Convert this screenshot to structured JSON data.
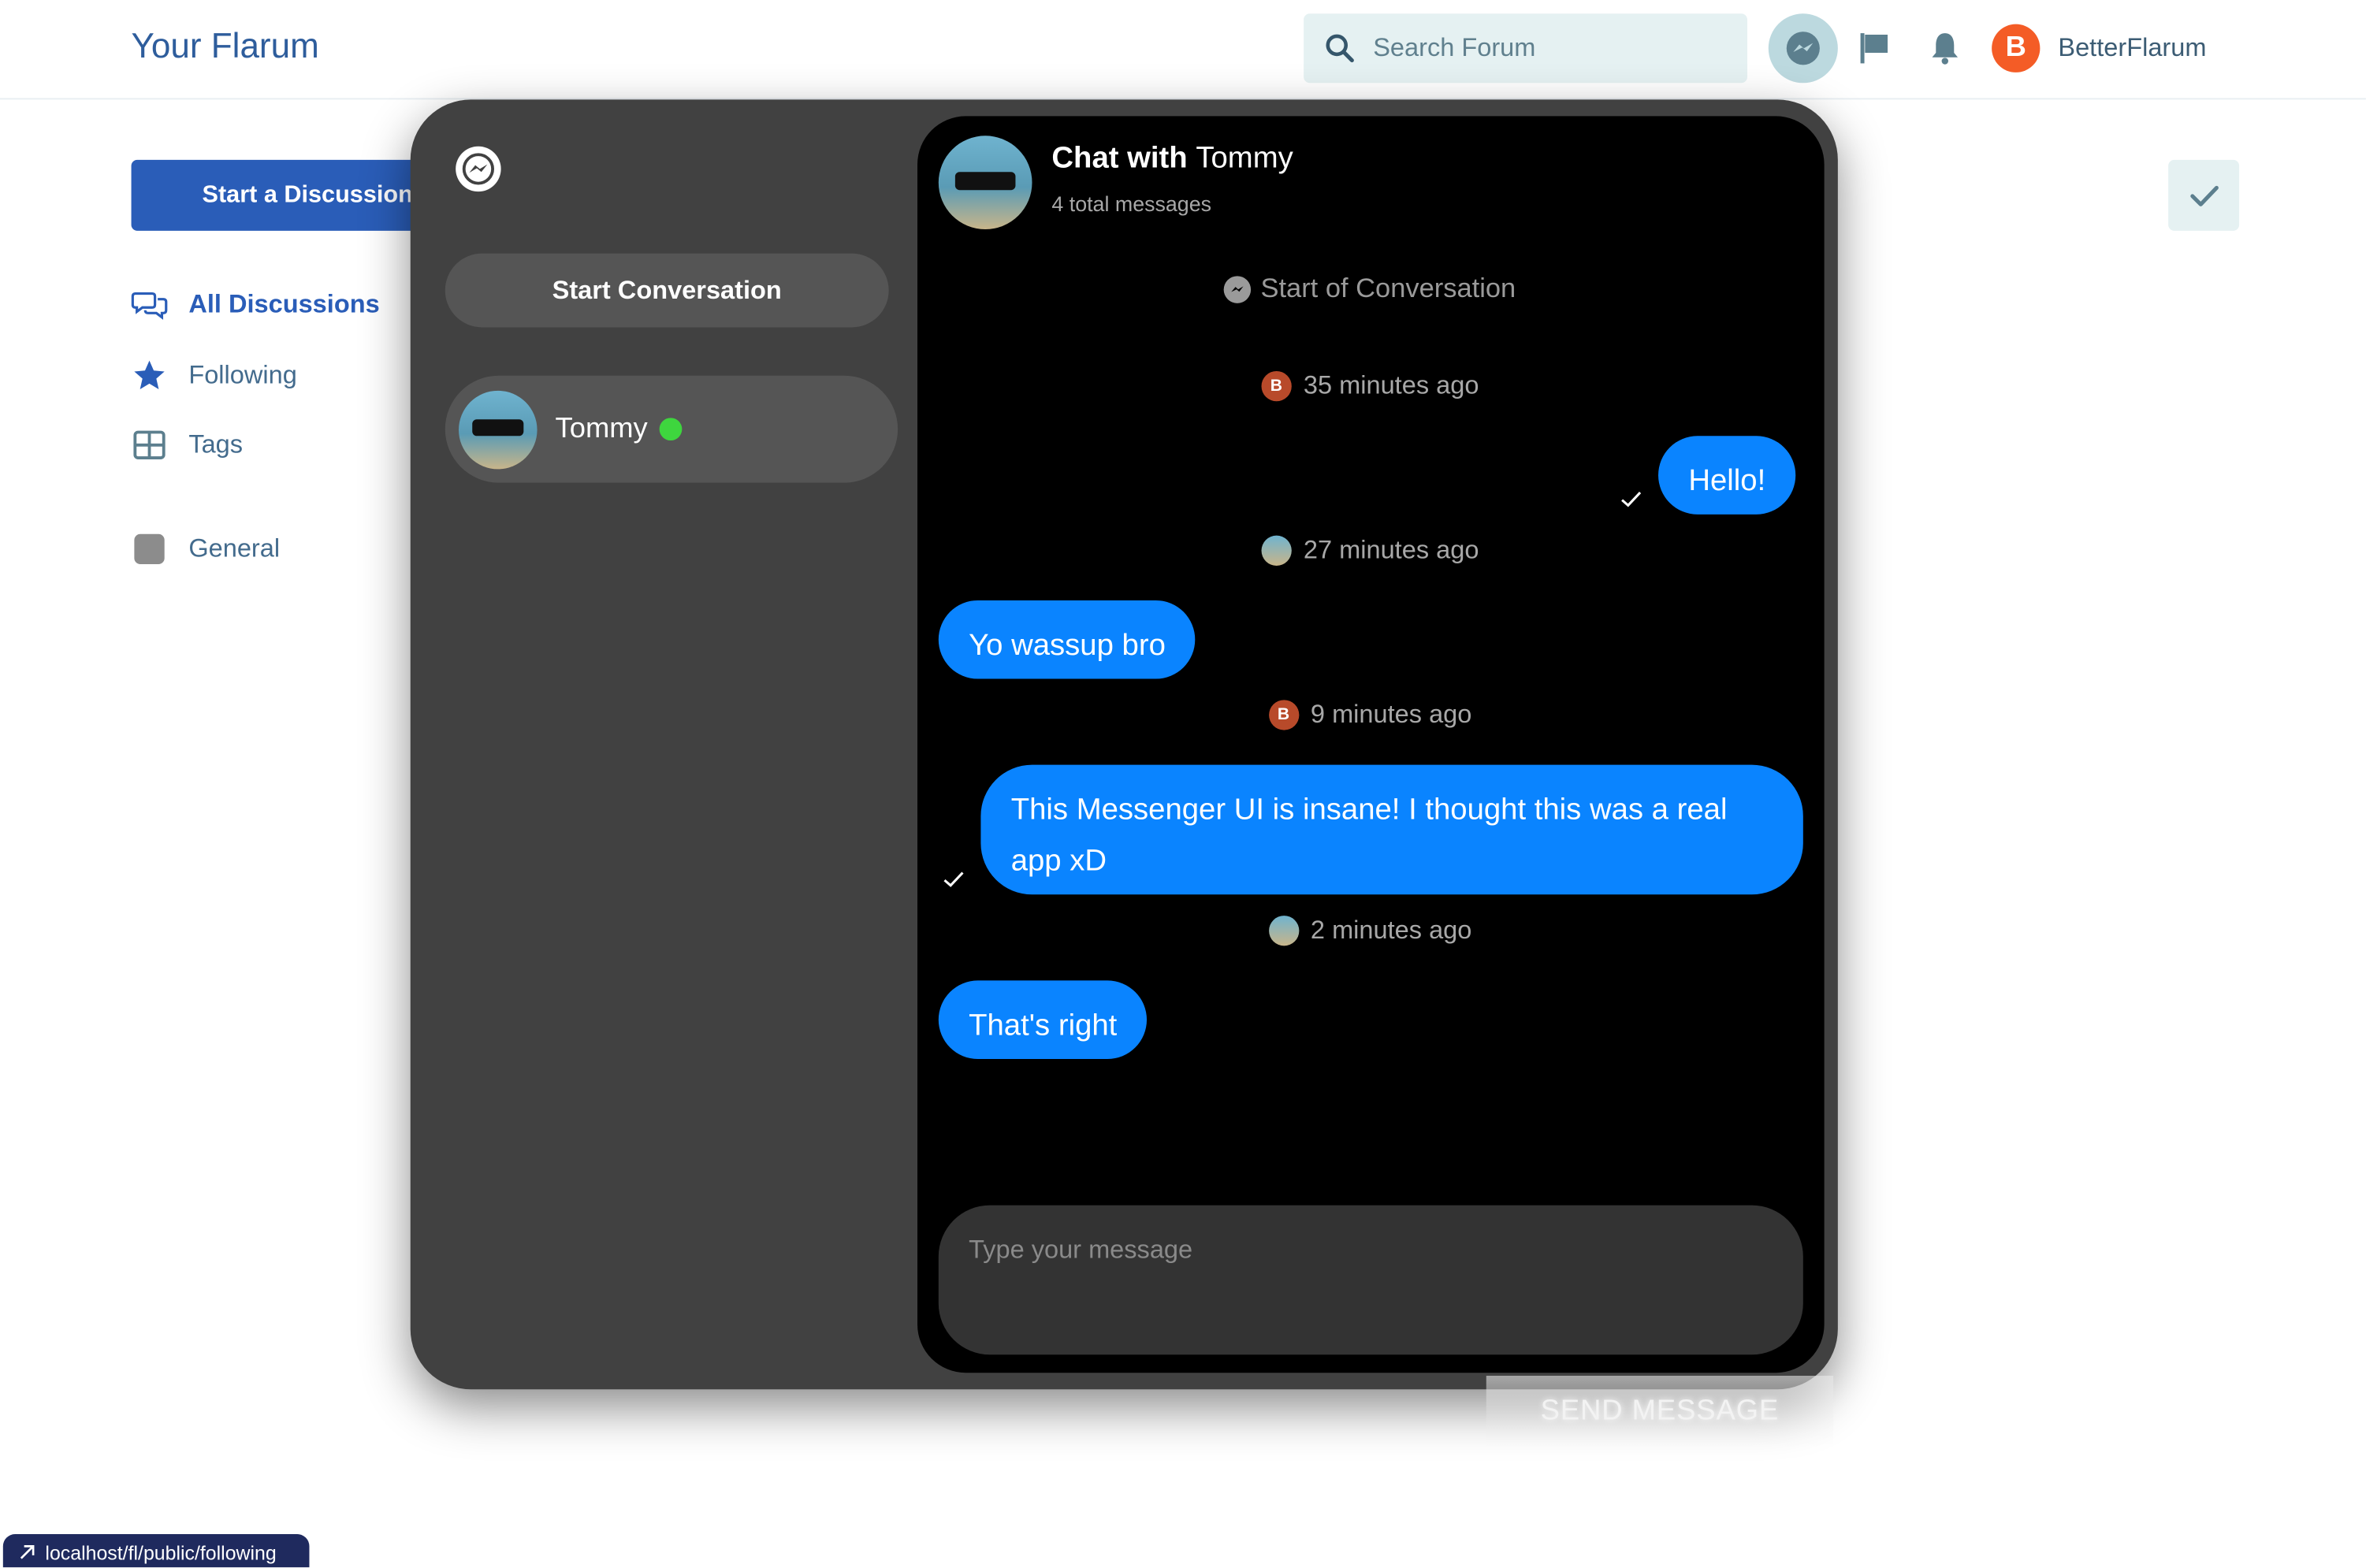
{
  "header": {
    "site_title": "Your Flarum",
    "search_placeholder": "Search Forum",
    "user_initial": "B",
    "user_name": "BetterFlarum"
  },
  "sidebar": {
    "start_discussion": "Start a Discussion",
    "nav": [
      {
        "label": "All Discussions",
        "icon": "comments-icon",
        "active": true
      },
      {
        "label": "Following",
        "icon": "star-icon",
        "active": false
      },
      {
        "label": "Tags",
        "icon": "tags-grid-icon",
        "active": false
      },
      {
        "label": "General",
        "icon": "tag-swatch",
        "active": false
      }
    ]
  },
  "messenger": {
    "start_conversation": "Start Conversation",
    "conversations": [
      {
        "name": "Tommy",
        "online": true
      }
    ],
    "chat": {
      "title_prefix": "Chat with",
      "title_name": "Tommy",
      "subtitle": "4 total messages",
      "start_label": "Start of Conversation",
      "messages": [
        {
          "time": "35 minutes ago",
          "author_initial": "B",
          "text": "Hello!",
          "mine": true
        },
        {
          "time": "27 minutes ago",
          "text": "Yo wassup bro",
          "mine": false
        },
        {
          "time": "9 minutes ago",
          "author_initial": "B",
          "text": "This Messenger UI is insane! I thought this was a real app xD",
          "mine": true
        },
        {
          "time": "2 minutes ago",
          "text": "That's right",
          "mine": false
        }
      ],
      "composer_placeholder": "Type your message",
      "send_label": "SEND MESSAGE"
    }
  },
  "status_bar": {
    "url": "localhost/fl/public/following"
  },
  "colors": {
    "accent": "#2a5db8",
    "bubble": "#0a84ff",
    "online": "#3ed63e",
    "panel": "#414141"
  }
}
